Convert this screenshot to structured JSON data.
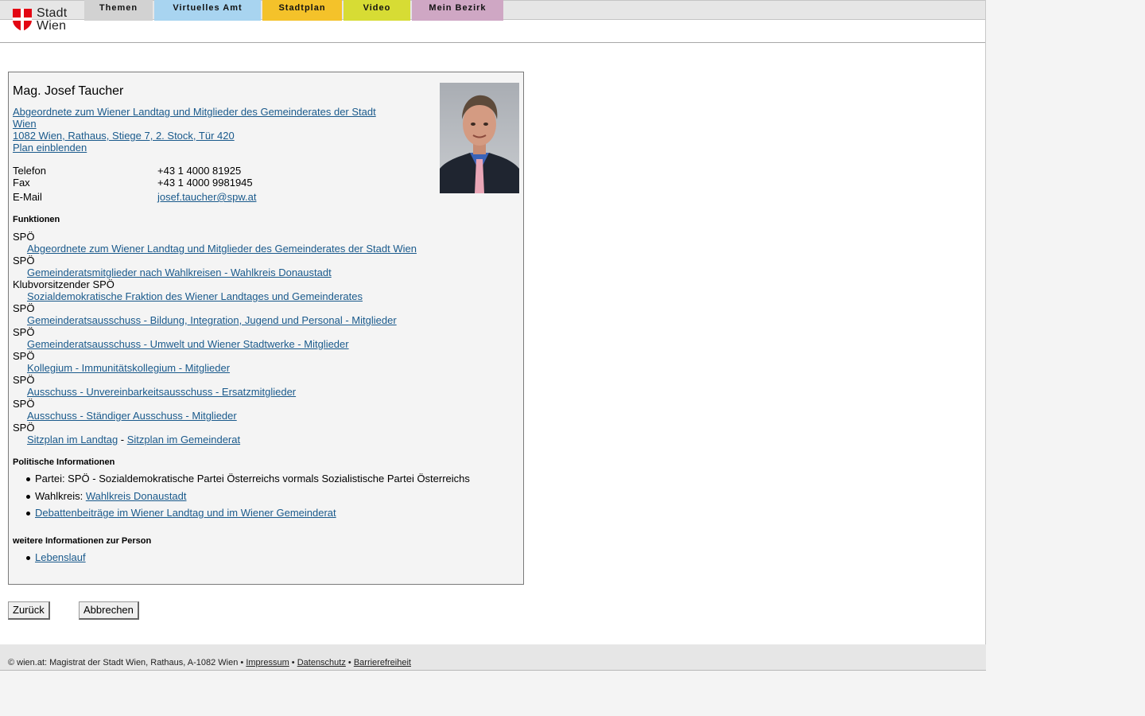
{
  "logo": {
    "line1": "Stadt",
    "line2": "Wien"
  },
  "nav": {
    "tabs": [
      {
        "label": "Themen"
      },
      {
        "label": "Virtuelles Amt"
      },
      {
        "label": "Stadtplan"
      },
      {
        "label": "Video"
      },
      {
        "label": "Mein Bezirk"
      }
    ]
  },
  "person": {
    "name": "Mag. Josef Taucher",
    "role_line1": "Abgeordnete zum Wiener Landtag und Mitglieder des Gemeinderates der Stadt",
    "role_line2": "Wien",
    "address": "1082 Wien, Rathaus, Stiege 7, 2. Stock, Tür 420",
    "plan_link": "Plan einblenden",
    "contact": {
      "phone_label": "Telefon",
      "phone": "+43 1 4000 81925",
      "fax_label": "Fax",
      "fax": "+43 1 4000 9981945",
      "email_label": "E-Mail",
      "email": "josef.taucher@spw.at"
    }
  },
  "functions": {
    "title": "Funktionen",
    "items": [
      {
        "party": "SPÖ",
        "link": "Abgeordnete zum Wiener Landtag und Mitglieder des Gemeinderates der Stadt Wien"
      },
      {
        "party": "SPÖ",
        "link": "Gemeinderatsmitglieder nach Wahlkreisen - Wahlkreis Donaustadt"
      },
      {
        "party": "Klubvorsitzender SPÖ",
        "link": "Sozialdemokratische Fraktion des Wiener Landtages und Gemeinderates"
      },
      {
        "party": "SPÖ",
        "link": "Gemeinderatsausschuss - Bildung, Integration, Jugend und Personal - Mitglieder"
      },
      {
        "party": "SPÖ",
        "link": "Gemeinderatsausschuss - Umwelt und Wiener Stadtwerke - Mitglieder"
      },
      {
        "party": "SPÖ",
        "link": "Kollegium - Immunitätskollegium - Mitglieder"
      },
      {
        "party": "SPÖ",
        "link": "Ausschuss - Unvereinbarkeitsausschuss - Ersatzmitglieder"
      },
      {
        "party": "SPÖ",
        "link": "Ausschuss - Ständiger Ausschuss - Mitglieder"
      }
    ],
    "last_party": "SPÖ",
    "seat_landtag": "Sitzplan im Landtag",
    "seat_separator": " - ",
    "seat_gemeinderat": "Sitzplan im Gemeinderat"
  },
  "political": {
    "title": "Politische Informationen",
    "party_text": "Partei: SPÖ - Sozialdemokratische Partei Österreichs vormals Sozialistische Partei Österreichs",
    "district_label": "Wahlkreis: ",
    "district_link": "Wahlkreis Donaustadt",
    "debates_link": "Debattenbeiträge im Wiener Landtag und im Wiener Gemeinderat"
  },
  "more": {
    "title": "weitere Informationen zur Person",
    "cv_link": "Lebenslauf"
  },
  "buttons": {
    "back": "Zurück",
    "cancel": "Abbrechen"
  },
  "footer": {
    "copyright": "© wien.at: Magistrat der Stadt Wien, Rathaus, A-1082 Wien",
    "sep": " • ",
    "impressum": "Impressum",
    "datenschutz": "Datenschutz",
    "barrierefreiheit": "Barrierefreiheit"
  },
  "colors": {
    "link": "#1a5a8c",
    "wien_red": "#e30613",
    "tab_themen": "#d2d2d2",
    "tab_amt": "#a8d4f0",
    "tab_stadtplan": "#f4c22a",
    "tab_video": "#d7dc34",
    "tab_bezirk": "#cfa7c4"
  }
}
